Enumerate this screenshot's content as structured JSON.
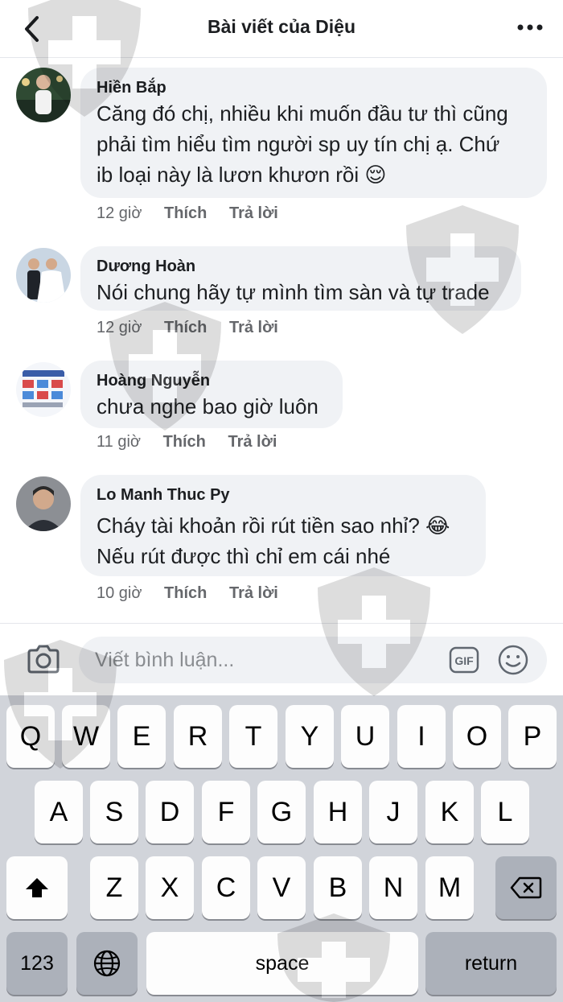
{
  "header": {
    "title": "Bài viết của Diệu"
  },
  "comments": [
    {
      "author": "Hiền Bắp",
      "lines": [
        "Căng đó chị, nhiều khi muốn đầu tư thì cũng",
        "phải tìm hiểu tìm người sp uy tín chị ạ. Chứ",
        "ib loại này là lươn khươn rồi 😌"
      ],
      "time": "12 giờ",
      "like": "Thích",
      "reply": "Trả lời"
    },
    {
      "author": "Dương Hoàn",
      "lines": [
        "Nói chung hãy tự mình tìm sàn và tự trade"
      ],
      "time": "12 giờ",
      "like": "Thích",
      "reply": "Trả lời"
    },
    {
      "author": "Hoàng Nguyễn",
      "lines": [
        "chưa nghe bao giờ luôn"
      ],
      "time": "11 giờ",
      "like": "Thích",
      "reply": "Trả lời"
    },
    {
      "author": "Lo Manh Thuc Py",
      "lines": [
        "Cháy tài khoản rồi rút tiền sao nhỉ? 😂",
        "Nếu rút được thì chỉ em cái nhé"
      ],
      "time": "10 giờ",
      "like": "Thích",
      "reply": "Trả lời"
    }
  ],
  "composer": {
    "placeholder": "Viết bình luận...",
    "gif_label": "GIF"
  },
  "keyboard": {
    "row1": [
      "Q",
      "W",
      "E",
      "R",
      "T",
      "Y",
      "U",
      "I",
      "O",
      "P"
    ],
    "row2": [
      "A",
      "S",
      "D",
      "F",
      "G",
      "H",
      "J",
      "K",
      "L"
    ],
    "row3": [
      "Z",
      "X",
      "C",
      "V",
      "B",
      "N",
      "M"
    ],
    "numbers": "123",
    "space": "space",
    "return": "return"
  },
  "icons": {
    "back": "chevron-left-icon",
    "more": "more-horizontal-icon",
    "camera": "camera-icon",
    "gif": "gif-icon",
    "emoji": "emoji-icon",
    "shift": "shift-icon",
    "delete": "backspace-icon",
    "globe": "globe-icon"
  }
}
